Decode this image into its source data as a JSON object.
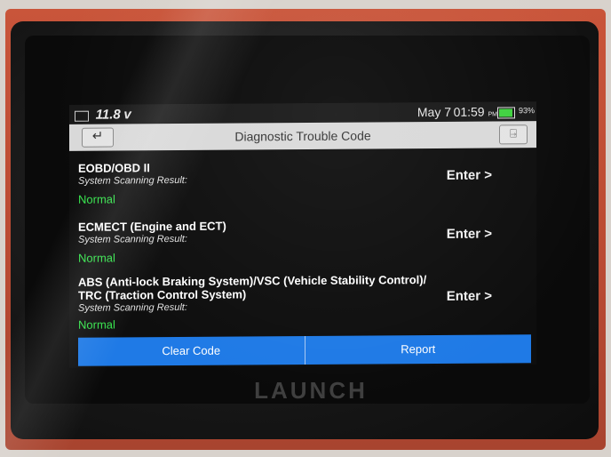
{
  "device": {
    "brand": "LAUNCH"
  },
  "status_bar": {
    "voltage": "11.8",
    "voltage_unit": "v",
    "date": "May 7",
    "time": "01:59",
    "ampm": "PM",
    "battery_percent": "93%",
    "battery_level": 0.93,
    "battery_color": "#3fd13f"
  },
  "header": {
    "title": "Diagnostic Trouble Code",
    "back_icon": "back-arrow-icon",
    "exit_icon": "exit-door-icon"
  },
  "systems": [
    {
      "name": "EOBD/OBD II",
      "label": "System Scanning Result:",
      "result": "Normal",
      "action": "Enter >"
    },
    {
      "name": "ECMECT (Engine and ECT)",
      "label": "System Scanning Result:",
      "result": "Normal",
      "action": "Enter >"
    },
    {
      "name": "ABS (Anti-lock Braking System)/VSC (Vehicle Stability Control)/",
      "name_line2": "TRC (Traction Control System)",
      "label": "System Scanning Result:",
      "result": "Normal",
      "action": "Enter >"
    }
  ],
  "footer": {
    "clear_code": "Clear Code",
    "report": "Report"
  },
  "colors": {
    "accent_blue": "#1f7ae6",
    "normal_green": "#33e24a",
    "case_orange": "#c9553a"
  }
}
